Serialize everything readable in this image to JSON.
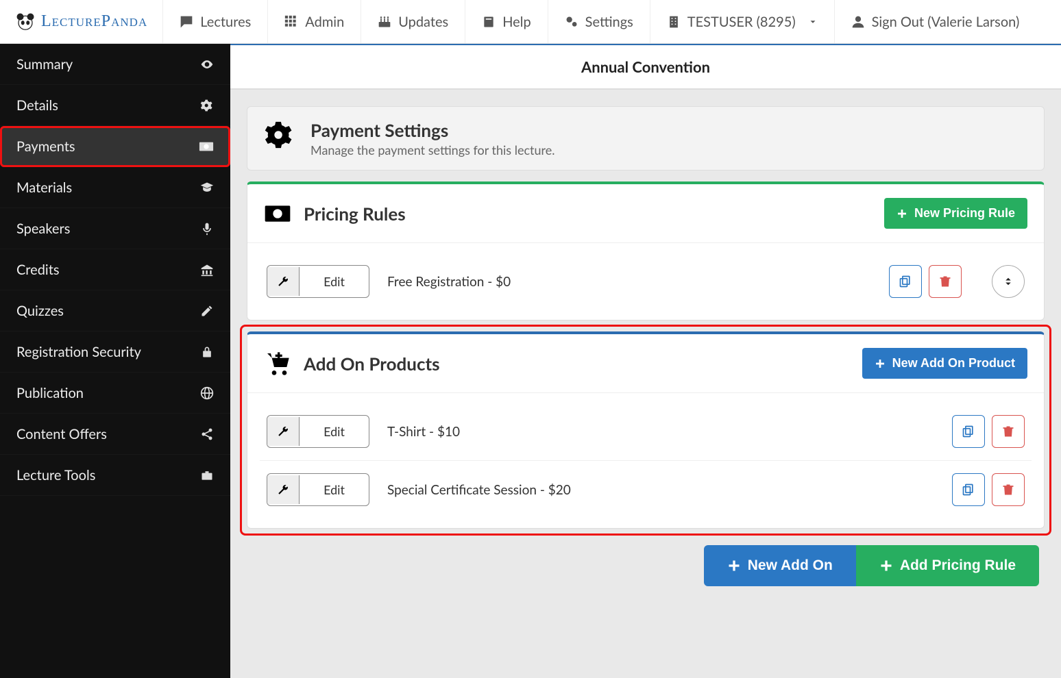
{
  "brand": "LecturePanda",
  "topnav": {
    "lectures": "Lectures",
    "admin": "Admin",
    "updates": "Updates",
    "help": "Help",
    "settings": "Settings",
    "org": "TESTUSER (8295)",
    "signout": "Sign Out (Valerie Larson)"
  },
  "sidebar": {
    "items": [
      {
        "label": "Summary"
      },
      {
        "label": "Details"
      },
      {
        "label": "Payments"
      },
      {
        "label": "Materials"
      },
      {
        "label": "Speakers"
      },
      {
        "label": "Credits"
      },
      {
        "label": "Quizzes"
      },
      {
        "label": "Registration Security"
      },
      {
        "label": "Publication"
      },
      {
        "label": "Content Offers"
      },
      {
        "label": "Lecture Tools"
      }
    ]
  },
  "page_title": "Annual Convention",
  "settings_panel": {
    "title": "Payment Settings",
    "subtitle": "Manage the payment settings for this lecture."
  },
  "pricing_panel": {
    "title": "Pricing Rules",
    "new_btn": "New Pricing Rule",
    "edit_label": "Edit",
    "rows": [
      {
        "label": "Free Registration - $0"
      }
    ]
  },
  "addon_panel": {
    "title": "Add On Products",
    "new_btn": "New Add On Product",
    "edit_label": "Edit",
    "rows": [
      {
        "label": "T-Shirt - $10"
      },
      {
        "label": "Special Certificate Session - $20"
      }
    ]
  },
  "footer": {
    "new_addon": "New Add On",
    "add_rule": "Add Pricing Rule"
  }
}
